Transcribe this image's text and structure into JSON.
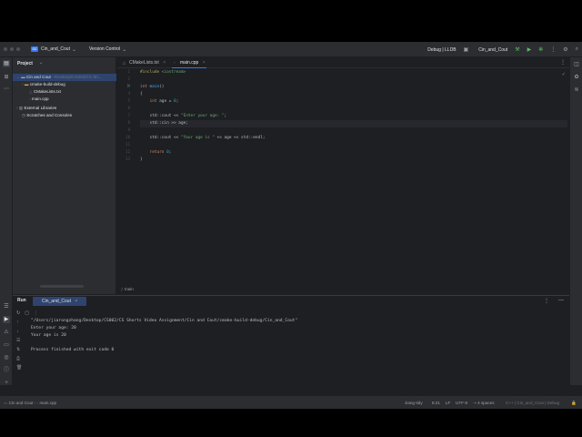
{
  "titlebar": {
    "project_badge": "CC",
    "project_name": "Cin_and_Cout",
    "vcs_label": "Version Control",
    "run_config": "Debug | LLDB",
    "target": "Cin_and_Cout"
  },
  "project_panel": {
    "title": "Project",
    "root_name": "Cin and Cout",
    "root_path": "~/Desktop/CS002/CS Sh...",
    "items": [
      {
        "label": "cmake-build-debug"
      },
      {
        "label": "CMakeLists.txt"
      },
      {
        "label": "main.cpp"
      },
      {
        "label": "External Libraries"
      },
      {
        "label": "Scratches and Consoles"
      }
    ]
  },
  "editor": {
    "tabs": [
      {
        "label": "CMakeLists.txt"
      },
      {
        "label": "main.cpp"
      }
    ],
    "line_numbers": [
      "1",
      "2",
      "3",
      "4",
      "5",
      "6",
      "7",
      "8",
      "9",
      "10",
      "11",
      "12",
      "13"
    ],
    "code_lines": {
      "l1": {
        "pp": "#include",
        "rest": " <iostream>"
      },
      "l3": {
        "kw": "int",
        "fn": " main",
        "rest": "()"
      },
      "l4": {
        "rest": "{"
      },
      "l5": {
        "kw": "    int",
        "rest": " age = ",
        "num": "0",
        "end": ";"
      },
      "l7": {
        "rest": "    std::cout << ",
        "str": "\"Enter your age: \"",
        "end": ";"
      },
      "l8": {
        "rest": "    std::cin >> age;"
      },
      "l10": {
        "rest": "    std::cout << ",
        "str": "\"Your age is \"",
        "end": " << age << std::endl;"
      },
      "l12": {
        "kw": "    return",
        "rest": " ",
        "num": "0",
        "end": ";"
      },
      "l13": {
        "rest": "}"
      }
    },
    "breadcrumb": "main"
  },
  "run_panel": {
    "title": "Run",
    "tab_label": "Cin_and_Cout",
    "output": [
      "\"/Users/jiarongzhang/Desktop/CS002/CS Shorts Video Assignment/Cin and Cout/cmake-build-debug/Cin_and_Cout\"",
      "Enter your age: 20",
      "Your age is 20",
      "",
      "Process finished with exit code 0"
    ]
  },
  "statusbar": {
    "path_root": "Cin and Cout",
    "path_file": "main.cpp",
    "user": "ziang-tidy",
    "cursor": "8:21",
    "line_ending": "LF",
    "encoding": "UTF-8",
    "indent": "4 spaces",
    "context": "C++ | Cin_and_Cout | Debug"
  }
}
